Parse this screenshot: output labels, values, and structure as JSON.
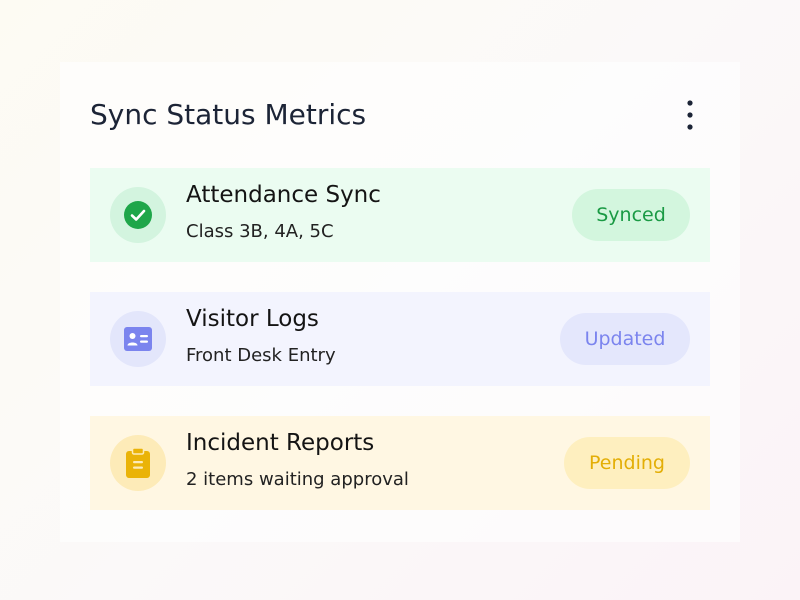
{
  "header": {
    "title": "Sync Status Metrics",
    "menu_icon": "more-vertical-icon"
  },
  "colors": {
    "title_text": "#1c2436",
    "green_bg": "#ebfcf1",
    "green_icon_bg": "#d3f4df",
    "green_accent": "#1fa64a",
    "blue_bg": "#f3f4fe",
    "blue_icon_bg": "#e3e6fb",
    "blue_accent": "#7b84ee",
    "amber_bg": "#fff7e3",
    "amber_icon_bg": "#fdebb8",
    "amber_accent": "#eab308"
  },
  "items": [
    {
      "title": "Attendance Sync",
      "subtitle": "Class 3B, 4A, 5C",
      "status": "Synced",
      "icon": "check-circle-icon"
    },
    {
      "title": "Visitor Logs",
      "subtitle": "Front Desk Entry",
      "status": "Updated",
      "icon": "id-card-icon"
    },
    {
      "title": "Incident Reports",
      "subtitle": "2 items waiting approval",
      "status": "Pending",
      "icon": "clipboard-icon"
    }
  ]
}
